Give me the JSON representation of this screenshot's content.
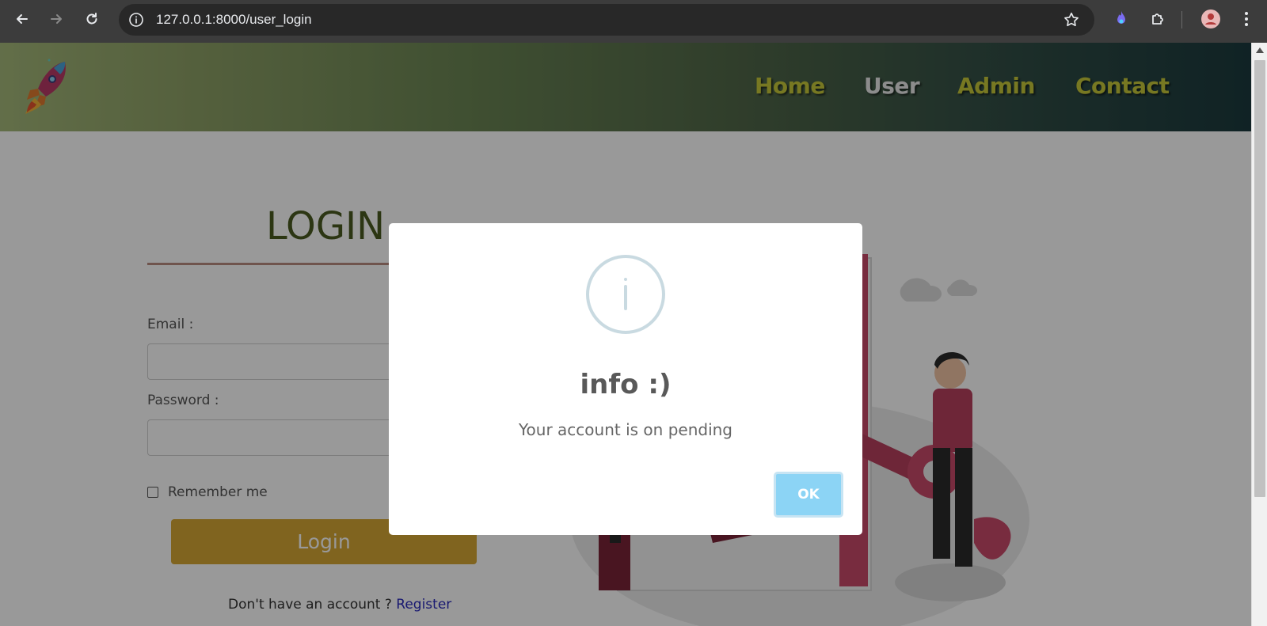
{
  "browser": {
    "url": "127.0.0.1:8000/user_login"
  },
  "navbar": {
    "links": [
      {
        "label": "Home"
      },
      {
        "label": "User"
      },
      {
        "label": "Admin"
      },
      {
        "label": "Contact"
      }
    ]
  },
  "login": {
    "title": "LOGIN",
    "email_label": "Email :",
    "email_value": "",
    "password_label": "Password :",
    "password_value": "",
    "remember_label": "Remember me",
    "remember_checked": false,
    "button_label": "Login",
    "register_prompt": "Don't have an account ?",
    "register_link": "Register"
  },
  "modal": {
    "icon": "info-icon",
    "title": "info :)",
    "message": "Your account is on pending",
    "ok_label": "OK"
  },
  "colors": {
    "nav_active": "#e9e9e9",
    "nav_link": "#c7c83a",
    "login_button": "#d6a735",
    "ok_button": "#8cd4f5",
    "title": "#4a5a21"
  }
}
